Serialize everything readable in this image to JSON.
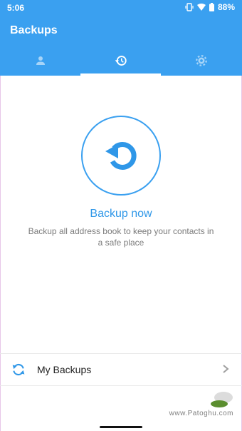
{
  "status_bar": {
    "time": "5:06",
    "battery": "88%"
  },
  "app": {
    "title": "Backups"
  },
  "tabs": [
    {
      "icon": "person-icon"
    },
    {
      "icon": "history-icon",
      "active": true
    },
    {
      "icon": "gear-icon"
    }
  ],
  "main": {
    "action_title": "Backup now",
    "action_desc": "Backup all address book to keep your contacts in a safe place"
  },
  "list": [
    {
      "label": "My Backups",
      "icon": "sync-icon"
    }
  ],
  "watermark": {
    "text": "www.Patoghu.com"
  },
  "colors": {
    "accent": "#3aa0f0"
  }
}
